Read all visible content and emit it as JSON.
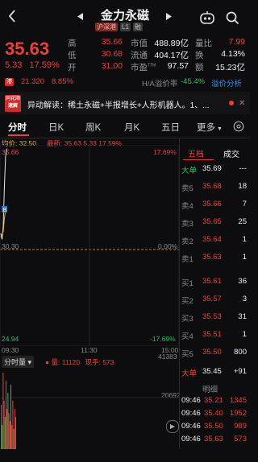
{
  "header": {
    "title": "金力永磁",
    "tags": [
      "沪深港",
      "L1",
      "融"
    ]
  },
  "quote": {
    "price": "35.63",
    "change": "5.33",
    "change_pct": "17.59%",
    "rows": [
      {
        "l1": "高",
        "v1": "35.66",
        "l2": "市值",
        "v2": "488.89亿",
        "l3": "量比",
        "v3": "7.99"
      },
      {
        "l1": "低",
        "v1": "30.68",
        "l2": "流通",
        "v2": "404.17亿",
        "l3": "换",
        "v3": "4.13%"
      },
      {
        "l1": "开",
        "v1": "31.00",
        "l2": "市盈",
        "v2": "97.57",
        "l3": "额",
        "v3": "15.23亿"
      }
    ],
    "pe_sup": "TTM"
  },
  "ticker": {
    "hk_badge": "港",
    "hk_price": "21.320",
    "hk_pct": "8.85%",
    "ah_label": "H/A溢价率",
    "ah_value": "-45.4%",
    "ah_link": "溢价分析"
  },
  "news": {
    "badge_top": "同花顺",
    "badge_bottom": "速解",
    "text": "异动解读：稀土永磁+半报增长+人形机器人。1、..."
  },
  "tabs": [
    "分时",
    "日K",
    "周K",
    "月K",
    "五日",
    "更多"
  ],
  "chart": {
    "avg_label": "均价: 32.50",
    "latest_label": "最新: 35.63  5.33  17.59%",
    "y_high": "35.66",
    "y_high_pct": "17.69%",
    "y_mid": "30.30",
    "y_mid_pct": "0.00%",
    "y_low": "24.94",
    "y_low_pct": "-17.69%",
    "x_start": "09:30",
    "x_mid": "11:30",
    "x_end": "15:00",
    "marker": "B"
  },
  "chart_data": {
    "type": "line",
    "x": [
      "09:30",
      "09:31",
      "09:32",
      "09:33",
      "09:34",
      "09:35"
    ],
    "series": [
      {
        "values": [
          31.0,
          30.68,
          31.4,
          33.5,
          35.2,
          35.63
        ]
      },
      {
        "values": [
          31.0,
          30.9,
          31.1,
          31.8,
          32.3,
          32.5
        ]
      }
    ],
    "ylim": [
      24.94,
      35.66
    ]
  },
  "volume": {
    "label": "分时量",
    "vol_label": "量: 11120",
    "cur_label": "现手: 573",
    "max": "41383",
    "mid": "20692",
    "bars": [
      0.55,
      0.3,
      0.95,
      0.6,
      0.4,
      0.85,
      0.5,
      0.7,
      0.45,
      0.35,
      0.8,
      0.3,
      0.6,
      0.25,
      0.5,
      0.4
    ]
  },
  "orderbook": {
    "tab_active": "五档",
    "tab_other": "成交",
    "big_sell_label": "大单",
    "big_sell_price": "35.69",
    "big_sell_vol": "---",
    "asks": [
      {
        "label": "卖5",
        "price": "35.68",
        "vol": "18"
      },
      {
        "label": "卖4",
        "price": "35.66",
        "vol": "7"
      },
      {
        "label": "卖3",
        "price": "35.65",
        "vol": "25"
      },
      {
        "label": "卖2",
        "price": "35.64",
        "vol": "1"
      },
      {
        "label": "卖1",
        "price": "35.63",
        "vol": "1"
      }
    ],
    "bids": [
      {
        "label": "买1",
        "price": "35.61",
        "vol": "36"
      },
      {
        "label": "买2",
        "price": "35.57",
        "vol": "3"
      },
      {
        "label": "买3",
        "price": "35.53",
        "vol": "31"
      },
      {
        "label": "买4",
        "price": "35.51",
        "vol": "1"
      },
      {
        "label": "买5",
        "price": "35.50",
        "vol": "800"
      }
    ],
    "big_buy_label": "大单",
    "big_buy_price": "35.45",
    "big_buy_vol": "+91",
    "detail_label": "明细",
    "trades": [
      {
        "time": "09:46",
        "price": "35.21",
        "vol": "1345"
      },
      {
        "time": "09:46",
        "price": "35.40",
        "vol": "1952"
      },
      {
        "time": "09:46",
        "price": "35.50",
        "vol": "989"
      },
      {
        "time": "09:46",
        "price": "35.63",
        "vol": "573"
      }
    ]
  }
}
